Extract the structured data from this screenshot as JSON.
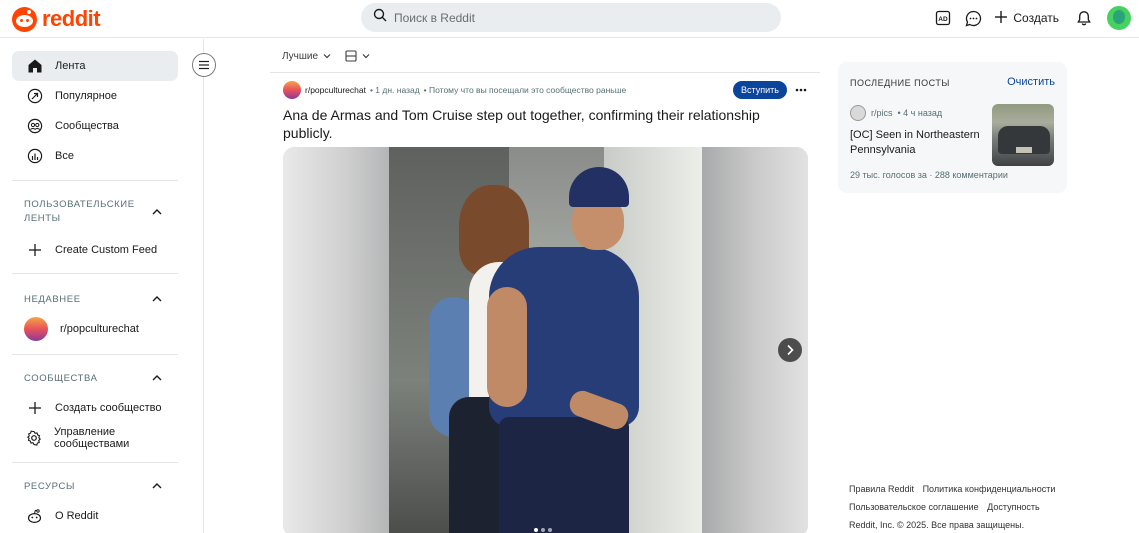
{
  "header": {
    "logo_text": "reddit",
    "search_placeholder": "Поиск в Reddit",
    "create_label": "Создать",
    "icons": [
      "ad-icon",
      "chat-icon",
      "plus-icon",
      "bell-icon",
      "avatar"
    ]
  },
  "sidebar": {
    "main": [
      {
        "label": "Лента",
        "icon": "home-icon",
        "active": true
      },
      {
        "label": "Популярное",
        "icon": "popular-icon"
      },
      {
        "label": "Сообщества",
        "icon": "communities-icon"
      },
      {
        "label": "Все",
        "icon": "all-icon"
      }
    ],
    "custom_feeds": {
      "title": "ПОЛЬЗОВАТЕЛЬСКИЕ ЛЕНТЫ",
      "items": [
        {
          "label": "Create Custom Feed",
          "icon": "plus-icon"
        }
      ]
    },
    "recent": {
      "title": "НЕДАВНЕЕ",
      "items": [
        {
          "label": "r/popculturechat"
        }
      ]
    },
    "communities": {
      "title": "СООБЩЕСТВА",
      "items": [
        {
          "label": "Создать сообщество",
          "icon": "plus-icon"
        },
        {
          "label": "Управление сообществами",
          "icon": "gear-icon"
        }
      ]
    },
    "resources": {
      "title": "РЕСУРСЫ",
      "items": [
        {
          "label": "О Reddit",
          "icon": "reddit-icon"
        }
      ]
    }
  },
  "feed": {
    "sort_label": "Лучшие",
    "post": {
      "subreddit": "r/popculturechat",
      "time": "• 1 дн. назад",
      "reason": "• Потому что вы посещали это сообщество раньше",
      "join_label": "Вступить",
      "title": "Ana de Armas and Tom Cruise step out together, confirming their relationship publicly.",
      "gallery_count": 3,
      "gallery_index": 1
    }
  },
  "recent_posts": {
    "title": "ПОСЛЕДНИЕ ПОСТЫ",
    "clear_label": "Очистить",
    "items": [
      {
        "subreddit": "r/pics",
        "time": "• 4 ч назад",
        "title": "[OC] Seen in Northeastern Pennsylvania",
        "stats": "29 тыс. голосов за  ·  288 комментарии"
      }
    ]
  },
  "footer": {
    "links": [
      "Правила Reddit",
      "Политика конфиденциальности",
      "Пользовательское соглашение",
      "Доступность"
    ],
    "copyright": "Reddit, Inc. © 2025. Все права защищены."
  },
  "colors": {
    "brand": "#ff4500",
    "join_button": "#0a449b",
    "active_nav": "#eaedef"
  }
}
